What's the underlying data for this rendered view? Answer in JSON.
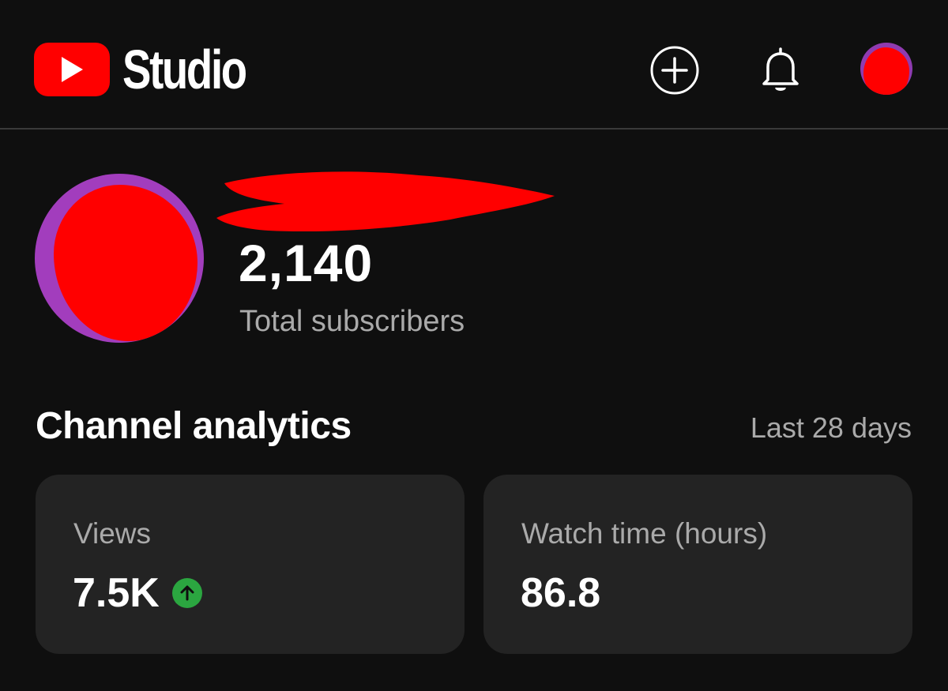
{
  "header": {
    "logo_text": "Studio",
    "brand_color": "#ff0000",
    "icons": [
      "youtube-play-icon",
      "create-plus-icon",
      "bell-icon",
      "account-avatar"
    ]
  },
  "channel": {
    "subscriber_count": "2,140",
    "subscriber_label": "Total subscribers"
  },
  "analytics": {
    "title": "Channel analytics",
    "period": "Last 28 days",
    "cards": [
      {
        "label": "Views",
        "value": "7.5K",
        "trend": "up",
        "trend_color": "#2ba640"
      },
      {
        "label": "Watch time (hours)",
        "value": "86.8"
      }
    ]
  }
}
